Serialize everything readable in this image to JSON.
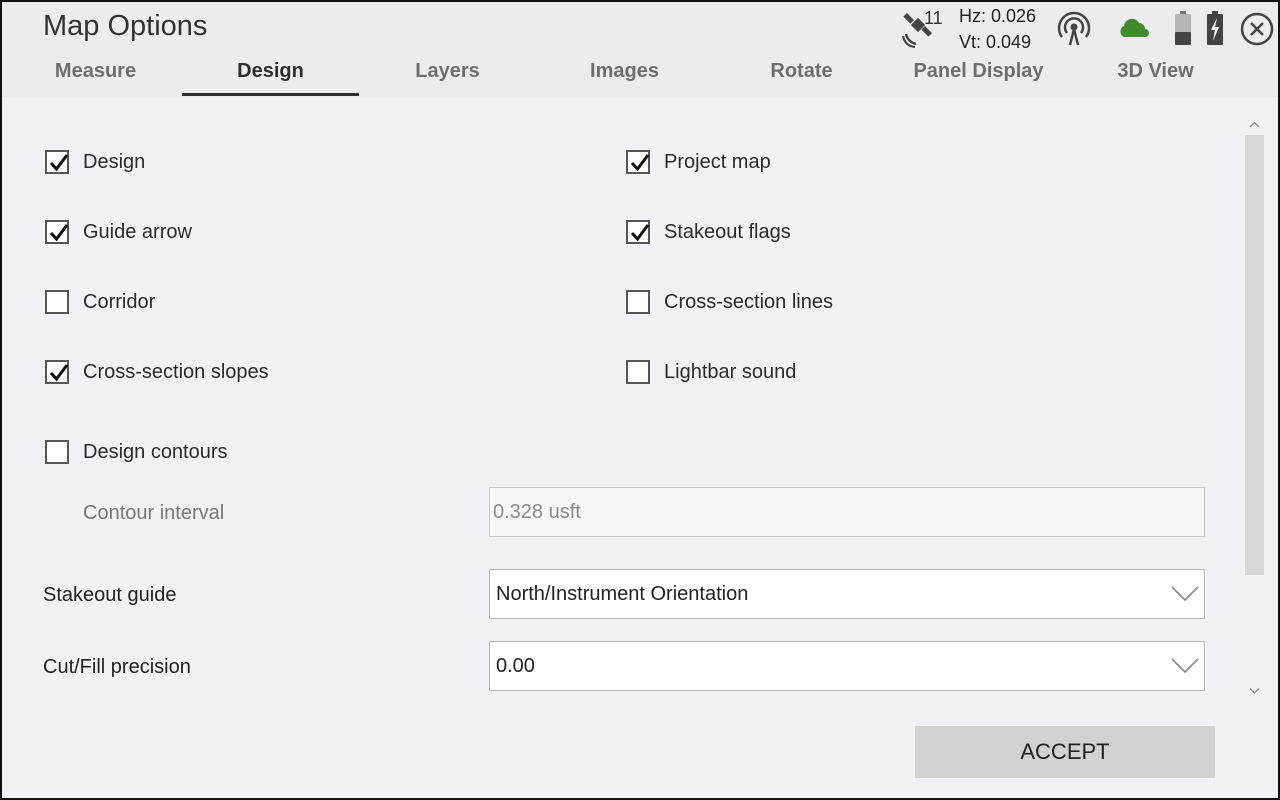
{
  "window": {
    "title": "Map Options"
  },
  "tabs": [
    {
      "label": "Measure",
      "active": false
    },
    {
      "label": "Design",
      "active": true
    },
    {
      "label": "Layers",
      "active": false
    },
    {
      "label": "Images",
      "active": false
    },
    {
      "label": "Rotate",
      "active": false
    },
    {
      "label": "Panel Display",
      "active": false
    },
    {
      "label": "3D View",
      "active": false
    }
  ],
  "status": {
    "satellites": "11",
    "hz": "Hz: 0.026",
    "vt": "Vt: 0.049",
    "icons": [
      "satellite-icon",
      "radio-signal-icon",
      "cloud-icon",
      "battery-icon",
      "battery-charging-icon",
      "close-icon"
    ],
    "cloud_color": "#3f8c2c"
  },
  "checkboxes": {
    "design": {
      "label": "Design",
      "checked": true
    },
    "project_map": {
      "label": "Project map",
      "checked": true
    },
    "guide_arrow": {
      "label": "Guide arrow",
      "checked": true
    },
    "stakeout_flags": {
      "label": "Stakeout flags",
      "checked": true
    },
    "corridor": {
      "label": "Corridor",
      "checked": false
    },
    "cross_section_lines": {
      "label": "Cross-section lines",
      "checked": false
    },
    "cross_section_slopes": {
      "label": "Cross-section slopes",
      "checked": true
    },
    "lightbar_sound": {
      "label": "Lightbar sound",
      "checked": false
    },
    "design_contours": {
      "label": "Design contours",
      "checked": false
    }
  },
  "fields": {
    "contour_interval": {
      "label": "Contour interval",
      "value": "0.328 usft"
    },
    "stakeout_guide": {
      "label": "Stakeout guide",
      "value": "North/Instrument Orientation"
    },
    "cut_fill_precision": {
      "label": "Cut/Fill precision",
      "value": "0.00"
    }
  },
  "actions": {
    "accept_label": "ACCEPT"
  }
}
